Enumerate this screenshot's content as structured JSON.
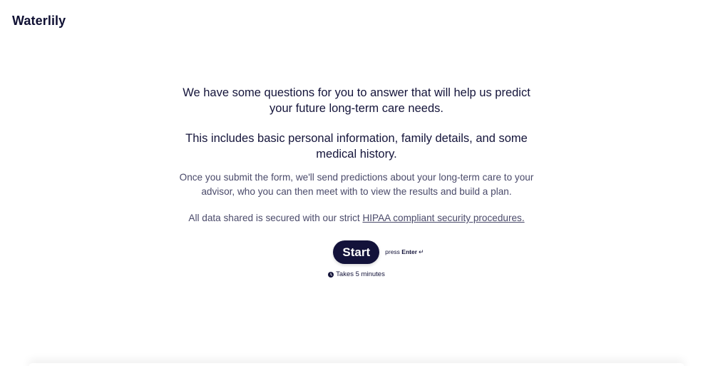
{
  "header": {
    "logo": "Waterlily"
  },
  "intro": {
    "headline_1": "We have some questions for you to answer that will help us predict your future long-term care needs.",
    "headline_2": "This includes basic personal information, family details, and some medical history.",
    "body": "Once you submit the form, we'll send predictions about your long-term care to your advisor, who you can then meet with to view the results and build a plan.",
    "security_prefix": "All data shared is secured with our strict ",
    "security_link": "HIPAA compliant security procedures."
  },
  "start": {
    "button_label": "Start",
    "hint_prefix": "press ",
    "hint_key": "Enter",
    "hint_icon": "↵",
    "duration": "Takes 5 minutes"
  },
  "colors": {
    "primary": "#13123a",
    "text_muted": "#4a4a6a"
  },
  "icons": {
    "clock": "clock-icon",
    "enter": "enter-key-icon"
  }
}
